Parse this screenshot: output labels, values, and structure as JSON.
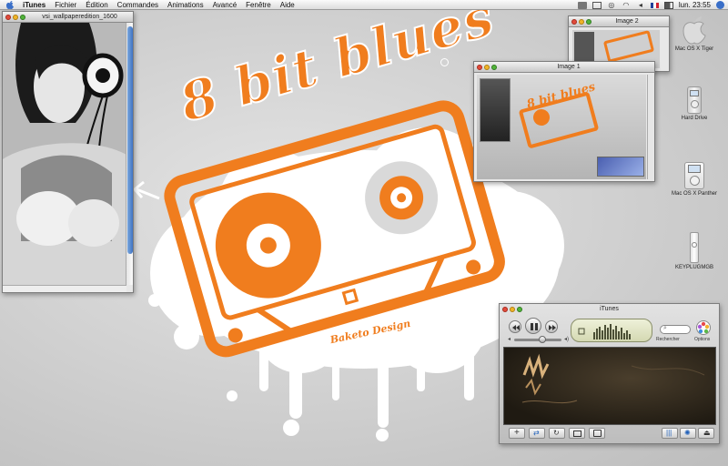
{
  "menubar": {
    "app_name": "iTunes",
    "items": [
      "Fichier",
      "Édition",
      "Commandes",
      "Animations",
      "Avancé",
      "Fenêtre",
      "Aide"
    ],
    "clock": "lun. 23:55"
  },
  "wallpaper": {
    "logo_text": "8 bit blues",
    "signature": "Baketo Design",
    "accent_color": "#f07d1e"
  },
  "photo_window": {
    "title": "vsi_wallpaperedition_1600"
  },
  "preview_windows": {
    "image2": {
      "title": "Image 2"
    },
    "image1": {
      "title": "Image 1"
    }
  },
  "desktop_icons": {
    "hd1": "Mac OS X Tiger",
    "hd2": "Hard Drive",
    "hd3": "Mac OS X Panther",
    "hd4": "KEYPLUGMGB"
  },
  "itunes": {
    "title": "iTunes",
    "search_label": "Rechercher",
    "options_label": "Options",
    "volume_level": 0.6
  }
}
